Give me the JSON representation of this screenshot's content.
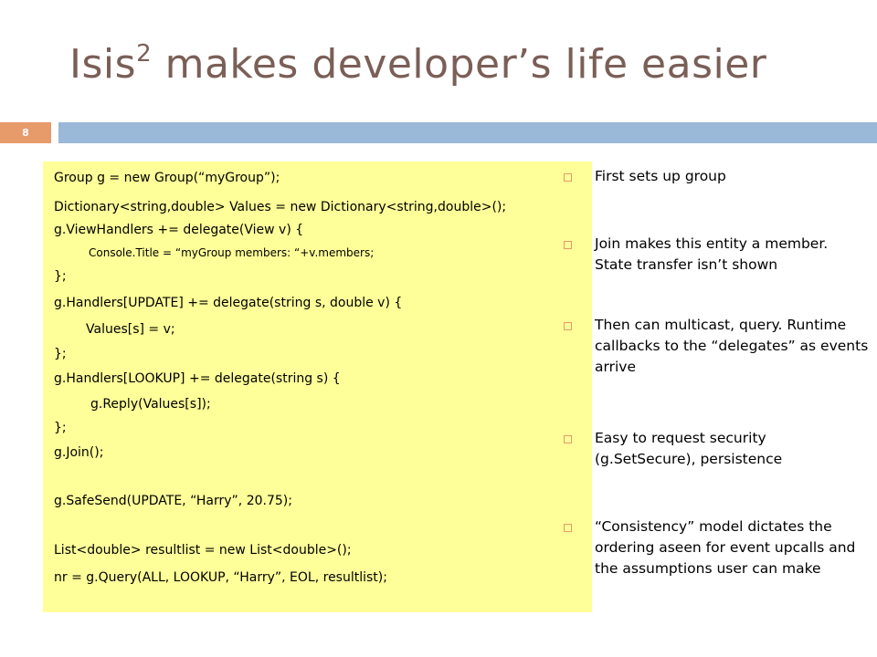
{
  "slide": {
    "title_main": "Isis",
    "title_sup": "2",
    "title_rest": " makes developer’s life easier",
    "slide_number": "8"
  },
  "code": [
    "Group g = new Group(“myGroup”);",
    "Dictionary<string,double> Values = new Dictionary<string,double>();",
    "g.ViewHandlers += delegate(View v) {",
    "Console.Title = “myGroup members: “+v.members;",
    "};",
    "g.Handlers[UPDATE] += delegate(string s, double v) {",
    "Values[s] = v;",
    "};",
    "g.Handlers[LOOKUP] += delegate(string s) {",
    "g.Reply(Values[s]);",
    "};",
    "g.Join();",
    "g.SafeSend(UPDATE, “Harry”, 20.75);",
    "List<double> resultlist = new List<double>();",
    "nr = g.Query(ALL, LOOKUP, “Harry”, EOL, resultlist);"
  ],
  "bullets": [
    "First sets up group",
    "Join makes this entity a member. State transfer isn’t shown",
    "Then can multicast, query. Runtime callbacks to the “delegates” as events arrive",
    "Easy to request security (g.SetSecure), persistence",
    "“Consistency” model dictates the ordering aseen for event upcalls and the assumptions user can make"
  ],
  "colors": {
    "title": "#7a5f57",
    "accent_orange": "#e79a6a",
    "accent_blue": "#9ab8d8",
    "code_background": "#ffff99"
  },
  "icons": {
    "bullet": "hollow-square-bullet-icon"
  }
}
